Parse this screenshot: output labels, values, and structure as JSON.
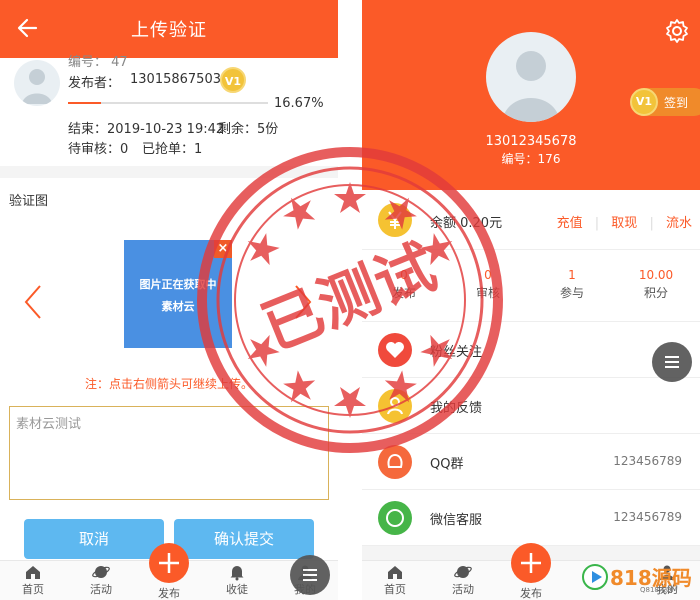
{
  "left": {
    "header": {
      "title": "上传验证"
    },
    "info": {
      "number_label": "编号：",
      "number_value": "47",
      "publisher_label": "发布者：",
      "publisher_value": "13015867503",
      "level": "V1",
      "progress_text": "16.67%",
      "progress": 0.1667,
      "end_text": "结束：2019-10-23 19:42",
      "remaining_text": "剩余：5份",
      "pending_text": "待审核：0",
      "grabbed_text": "已抢单：1"
    },
    "section": {
      "label": "验证图"
    },
    "image": {
      "line1": "图片正在获取中",
      "line2": "素材云",
      "close": "×"
    },
    "note": "注：点击右侧箭头可继续上传。",
    "textarea_value": "素材云测试",
    "buttons": {
      "cancel": "取消",
      "submit": "确认提交"
    },
    "nav": {
      "home": "首页",
      "activity": "活动",
      "publish": "发布",
      "collect": "收徒",
      "mine": "我的"
    }
  },
  "right": {
    "phone": "13012345678",
    "uid": "编号：176",
    "level": "V1",
    "signin": "签到",
    "balance": {
      "text": "余额 0.20元",
      "recharge": "充值",
      "withdraw": "取现",
      "flow": "流水"
    },
    "stats": [
      {
        "num": "0",
        "label": "发布"
      },
      {
        "num": "0",
        "label": "审核"
      },
      {
        "num": "1",
        "label": "参与"
      },
      {
        "num": "10.00",
        "label": "积分"
      }
    ],
    "rows": {
      "fans": "粉丝关注",
      "feedback": "我的反馈",
      "qq": {
        "label": "QQ群",
        "value": "123456789"
      },
      "wechat": {
        "label": "微信客服",
        "value": "123456789"
      }
    },
    "nav": {
      "home": "首页",
      "activity": "活动",
      "publish": "发布",
      "mine": "我的"
    }
  },
  "stamp": {
    "text": "已测试"
  },
  "watermark": {
    "text": "818源码",
    "sub": "Q818.COM"
  },
  "colors": {
    "accent": "#fb5a28",
    "blue_button": "#5eb8f0",
    "stamp_red": "#e23b3b"
  },
  "icons": [
    "back-arrow-icon",
    "gear-icon",
    "chevron-left-icon",
    "chevron-right-icon",
    "close-icon",
    "home-icon",
    "planet-icon",
    "plus-icon",
    "bell-icon",
    "menu-icon",
    "yen-icon",
    "heart-icon",
    "person-icon",
    "chat-icon",
    "ring-icon"
  ]
}
